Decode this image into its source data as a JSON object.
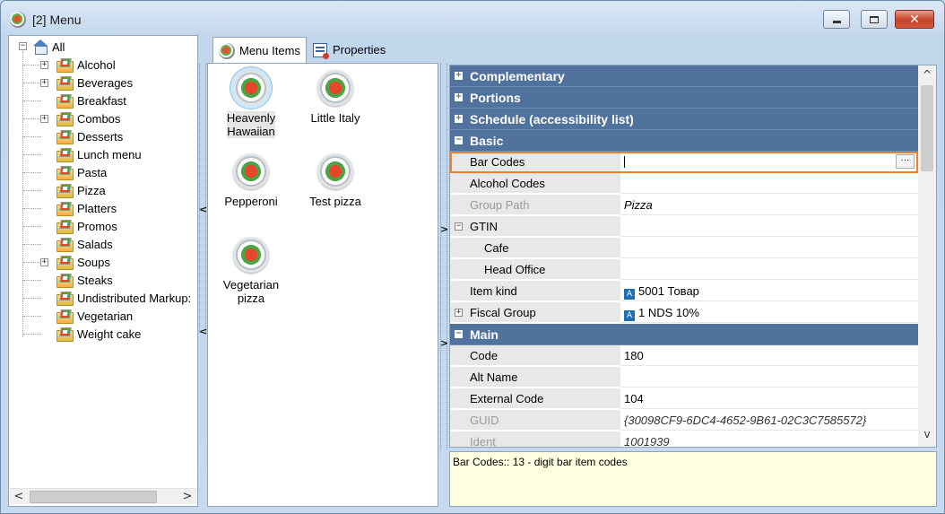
{
  "window": {
    "title": "[2] Menu",
    "controls": {
      "minimize": "minimize",
      "maximize": "maximize",
      "close": "✕"
    }
  },
  "tree": {
    "root": "All",
    "items": [
      {
        "label": "Alcohol",
        "expandable": true
      },
      {
        "label": "Beverages",
        "expandable": true
      },
      {
        "label": "Breakfast",
        "expandable": false
      },
      {
        "label": "Combos",
        "expandable": true
      },
      {
        "label": "Desserts",
        "expandable": false
      },
      {
        "label": "Lunch menu",
        "expandable": false
      },
      {
        "label": "Pasta",
        "expandable": false
      },
      {
        "label": "Pizza",
        "expandable": false,
        "selected": true
      },
      {
        "label": "Platters",
        "expandable": false
      },
      {
        "label": "Promos",
        "expandable": false
      },
      {
        "label": "Salads",
        "expandable": false
      },
      {
        "label": "Soups",
        "expandable": true
      },
      {
        "label": "Steaks",
        "expandable": false
      },
      {
        "label": "Undistributed Markup:",
        "expandable": false
      },
      {
        "label": "Vegetarian",
        "expandable": false
      },
      {
        "label": "Weight cake",
        "expandable": false
      }
    ]
  },
  "tabs": [
    {
      "label": "Menu Items",
      "active": true
    },
    {
      "label": "Properties",
      "active": false
    }
  ],
  "menu_items": [
    {
      "label": "Heavenly Hawaiian",
      "selected": true
    },
    {
      "label": "Little Italy"
    },
    {
      "label": "Pepperoni"
    },
    {
      "label": "Test pizza"
    },
    {
      "label": "Vegetarian pizza"
    }
  ],
  "properties": {
    "categories": {
      "complementary": "Complementary",
      "portions": "Portions",
      "schedule": "Schedule (accessibility list)",
      "basic": "Basic",
      "main": "Main"
    },
    "rows": {
      "bar_codes": {
        "name": "Bar Codes",
        "value": ""
      },
      "alcohol_codes": {
        "name": "Alcohol Codes",
        "value": ""
      },
      "group_path": {
        "name": "Group Path",
        "value": "Pizza"
      },
      "gtin": {
        "name": "GTIN",
        "value": ""
      },
      "cafe": {
        "name": "Cafe",
        "value": ""
      },
      "head_office": {
        "name": "Head Office",
        "value": ""
      },
      "item_kind": {
        "name": "Item kind",
        "value": "5001 Товар"
      },
      "fiscal_group": {
        "name": "Fiscal Group",
        "value": "1 NDS 10%"
      },
      "code": {
        "name": "Code",
        "value": "180"
      },
      "alt_name": {
        "name": "Alt Name",
        "value": ""
      },
      "external_code": {
        "name": "External Code",
        "value": "104"
      },
      "guid": {
        "name": "GUID",
        "value": "{30098CF9-6DC4-4652-9B61-02C3C7585572}"
      },
      "ident": {
        "name": "Ident",
        "value": "1001939"
      }
    },
    "ellipsis": "···",
    "badge": "A"
  },
  "description": "Bar Codes:: 13 - digit bar item codes",
  "glyphs": {
    "plus": "+",
    "minus": "−",
    "left": "<",
    "right": ">",
    "up": "^",
    "down": "v"
  },
  "colors": {
    "category_bg": "#50729c",
    "highlight": "#f07e2a",
    "description_bg": "#ffffe1"
  }
}
